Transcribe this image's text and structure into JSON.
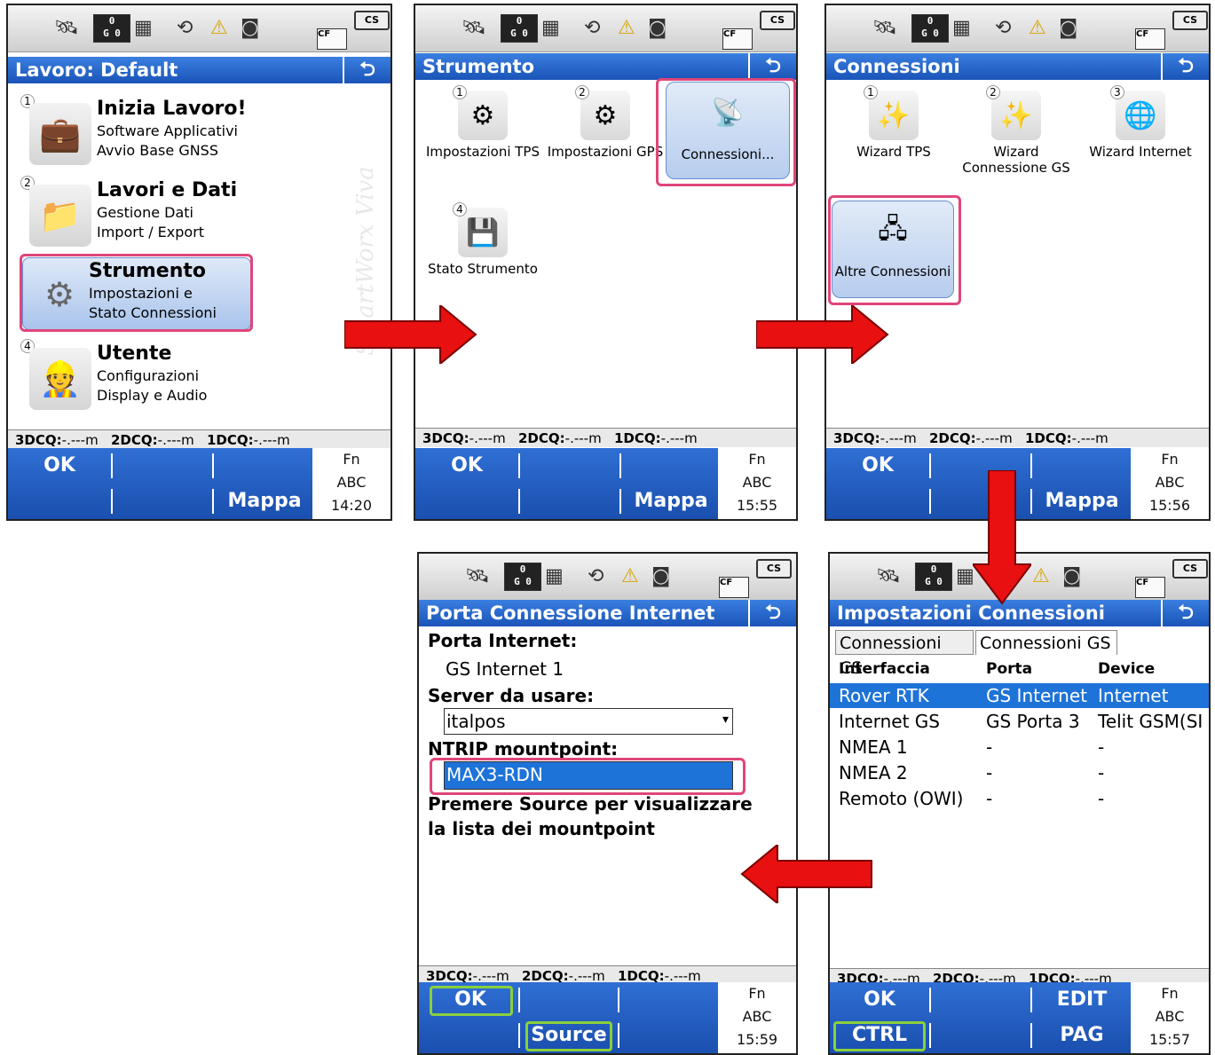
{
  "status": {
    "sat_top": "0",
    "sigma_top": "0",
    "sat_bot": "G 0",
    "sigma_bot": "0",
    "battery": "CS",
    "card": "CF"
  },
  "dcq": {
    "d3": "3DCQ:",
    "d3v": "-.---m",
    "d2": "2DCQ:",
    "d2v": "-.---m",
    "d1": "1DCQ:",
    "d1v": "-.---m"
  },
  "screen1": {
    "title": "Lavoro: Default",
    "watermark": "SmartWorx Viva",
    "items": [
      {
        "num": "1",
        "title": "Inizia Lavoro!",
        "l1": "Software Applicativi",
        "l2": "Avvio Base GNSS"
      },
      {
        "num": "2",
        "title": "Lavori e Dati",
        "l1": "Gestione Dati",
        "l2": "Import / Export"
      },
      {
        "num": "3",
        "title": "Strumento",
        "l1": "Impostazioni e",
        "l2": "Stato Connessioni"
      },
      {
        "num": "4",
        "title": "Utente",
        "l1": "Configurazioni",
        "l2": "Display e Audio"
      }
    ],
    "keys": {
      "ok": "OK",
      "map": "Mappa",
      "fn": "Fn",
      "abc": "ABC",
      "time": "14:20"
    }
  },
  "screen2": {
    "title": "Strumento",
    "tiles": [
      {
        "num": "1",
        "label": "Impostazioni TPS"
      },
      {
        "num": "2",
        "label": "Impostazioni GPS"
      },
      {
        "num": "3",
        "label": "Connessioni..."
      },
      {
        "num": "4",
        "label": "Stato Strumento"
      }
    ],
    "keys": {
      "ok": "OK",
      "map": "Mappa",
      "fn": "Fn",
      "abc": "ABC",
      "time": "15:55"
    }
  },
  "screen3": {
    "title": "Connessioni",
    "tiles": [
      {
        "num": "1",
        "label": "Wizard TPS"
      },
      {
        "num": "2",
        "label": "Wizard Connessione GS"
      },
      {
        "num": "3",
        "label": "Wizard Internet"
      },
      {
        "num": "4",
        "label": "Altre Connessioni"
      }
    ],
    "keys": {
      "ok": "OK",
      "map": "Mappa",
      "fn": "Fn",
      "abc": "ABC",
      "time": "15:56"
    }
  },
  "screen4": {
    "title": "Porta Connessione Internet",
    "port_label": "Porta Internet:",
    "port_value": "GS Internet 1",
    "server_label": "Server da usare:",
    "server_value": "italpos",
    "mount_label": "NTRIP mountpoint:",
    "mount_value": "MAX3-RDN",
    "hint1": "Premere Source per visualizzare",
    "hint2": "la lista dei mountpoint",
    "keys": {
      "ok": "OK",
      "source": "Source",
      "fn": "Fn",
      "abc": "ABC",
      "time": "15:59"
    }
  },
  "screen5": {
    "title": "Impostazioni Connessioni",
    "tabs": [
      "Connessioni CS",
      "Connessioni GS"
    ],
    "headers": [
      "Interfaccia",
      "Porta",
      "Device"
    ],
    "rows": [
      [
        "Rover RTK",
        "GS Internet",
        "Internet"
      ],
      [
        "Internet GS",
        "GS Porta 3",
        "Telit GSM(SI"
      ],
      [
        "NMEA 1",
        "-",
        "-"
      ],
      [
        "NMEA 2",
        "-",
        "-"
      ],
      [
        "Remoto (OWI)",
        "-",
        "-"
      ]
    ],
    "keys": {
      "ok": "OK",
      "edit": "EDIT",
      "ctrl": "CTRL",
      "pag": "PAG",
      "fn": "Fn",
      "abc": "ABC",
      "time": "15:57"
    }
  }
}
